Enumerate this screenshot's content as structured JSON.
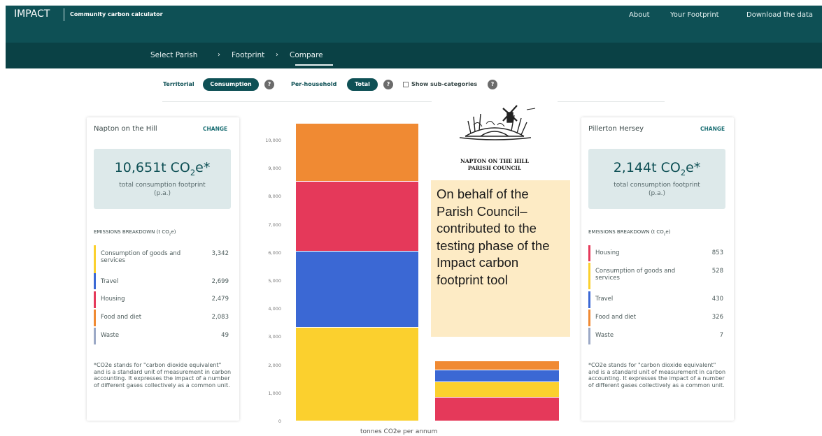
{
  "header": {
    "brand": "IMPACT",
    "brand_subtitle": "Community carbon calculator",
    "nav": [
      "About",
      "Your Footprint",
      "Download the data"
    ]
  },
  "breadcrumb": [
    "Select Parish",
    "Footprint",
    "Compare"
  ],
  "controls": {
    "territorial": "Territorial",
    "consumption": "Consumption",
    "per_household": "Per-household",
    "total": "Total",
    "show_subcategories": "Show sub-categories",
    "help_glyph": "?"
  },
  "left_card": {
    "name": "Napton on the Hill",
    "change": "CHANGE",
    "total_value": "10,651t CO2e*",
    "total_subtitle": "total consumption footprint (p.a.)",
    "breakdown_title": "EMISSIONS BREAKDOWN (t CO2e)",
    "rows": [
      {
        "label": "Consumption of goods and services",
        "value": "3,342",
        "color": "#fbd02e"
      },
      {
        "label": "Travel",
        "value": "2,699",
        "color": "#3b68d4"
      },
      {
        "label": "Housing",
        "value": "2,479",
        "color": "#e5395a"
      },
      {
        "label": "Food and diet",
        "value": "2,083",
        "color": "#f08a33"
      },
      {
        "label": "Waste",
        "value": "49",
        "color": "#9ca9c6"
      }
    ],
    "note": "*CO2e stands for \"carbon dioxide equivalent\" and is a standard unit of measurement in carbon accounting. It expresses the impact of a number of different gases collectively as a common unit."
  },
  "right_card": {
    "name": "Pillerton Hersey",
    "change": "CHANGE",
    "total_value": "2,144t CO2e*",
    "total_subtitle": "total consumption footprint (p.a.)",
    "breakdown_title": "EMISSIONS BREAKDOWN (t CO2e)",
    "rows": [
      {
        "label": "Housing",
        "value": "853",
        "color": "#e5395a"
      },
      {
        "label": "Consumption of goods and services",
        "value": "528",
        "color": "#fbd02e"
      },
      {
        "label": "Travel",
        "value": "430",
        "color": "#3b68d4"
      },
      {
        "label": "Food and diet",
        "value": "326",
        "color": "#f08a33"
      },
      {
        "label": "Waste",
        "value": "7",
        "color": "#9ca9c6"
      }
    ],
    "note": "*CO2e stands for \"carbon dioxide equivalent\" and is a standard unit of measurement in carbon accounting. It expresses the impact of a number of different gases collectively as a common unit."
  },
  "chart_data": {
    "type": "bar",
    "stacked": true,
    "categories": [
      "Napton on the Hill",
      "Pillerton Hersey"
    ],
    "ylim": [
      0,
      10000
    ],
    "xlabel": "tonnes CO2e per annum",
    "ticks": [
      "0",
      "1,000",
      "2,000",
      "3,000",
      "4,000",
      "5,000",
      "6,000",
      "7,000",
      "8,000",
      "9,000",
      "10,000"
    ],
    "series": [
      {
        "name": "Consumption of goods and services",
        "color": "#fbd02e",
        "values": [
          3342,
          528
        ]
      },
      {
        "name": "Travel",
        "color": "#3b68d4",
        "values": [
          2699,
          430
        ]
      },
      {
        "name": "Housing",
        "color": "#e5395a",
        "values": [
          2479,
          853
        ]
      },
      {
        "name": "Food and diet",
        "color": "#f08a33",
        "values": [
          2083,
          326
        ]
      },
      {
        "name": "Waste",
        "color": "#9ca9c6",
        "values": [
          49,
          7
        ]
      }
    ],
    "pillerton_order": [
      "Housing",
      "Consumption of goods and services",
      "Travel",
      "Food and diet"
    ]
  },
  "overlay": {
    "logo_line1": "NAPTON ON THE HILL",
    "logo_line2": "PARISH COUNCIL",
    "callout": "On behalf of the Parish Council– contributed to the testing phase of the Impact carbon footprint tool"
  }
}
